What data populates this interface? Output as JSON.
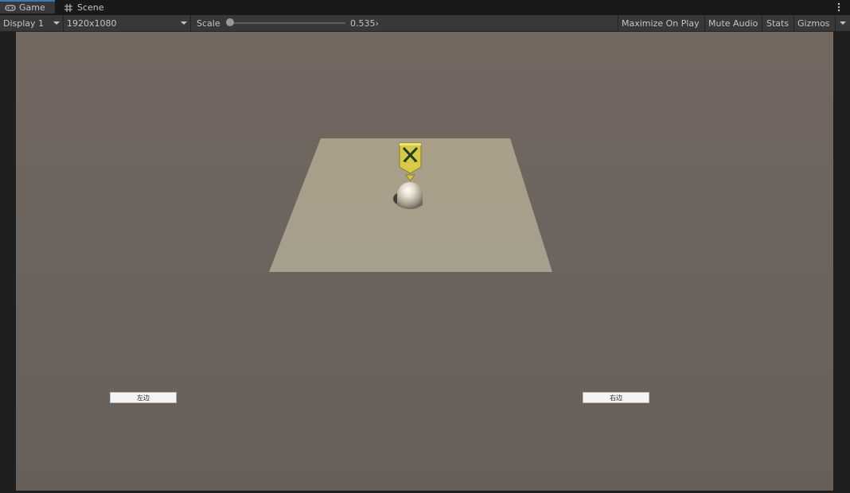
{
  "tabs": [
    {
      "label": "Game",
      "icon": "gamepad-icon",
      "active": true
    },
    {
      "label": "Scene",
      "icon": "grid-icon",
      "active": false
    }
  ],
  "toolbar": {
    "display": "Display 1",
    "resolution": "1920x1080",
    "scale_label": "Scale",
    "scale_value": "0.535›",
    "maximize_on_play": "Maximize On Play",
    "mute_audio": "Mute Audio",
    "stats": "Stats",
    "gizmos": "Gizmos"
  },
  "game_ui": {
    "left_button": "左边",
    "right_button": "右边"
  },
  "colors": {
    "accent": "#3a79bb",
    "toolbar_bg": "#383838",
    "ground": "#a69e89",
    "badge": "#d8c94a"
  }
}
